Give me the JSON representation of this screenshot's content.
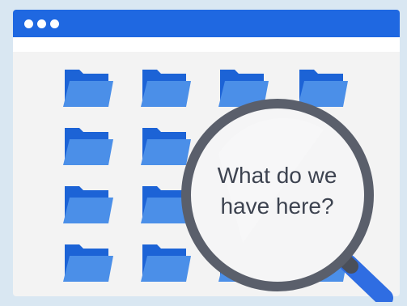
{
  "window": {
    "title_controls": [
      "dot",
      "dot",
      "dot"
    ],
    "colors": {
      "titlebar": "#1f68e1",
      "folder_front": "#4b8fe8",
      "folder_back": "#1c63d6",
      "lens_ring": "#5a5f6b",
      "handle": "#2f6de2"
    }
  },
  "magnifier": {
    "line1": "What do we",
    "line2": "have here?"
  },
  "folders": [
    {
      "name": "folder"
    },
    {
      "name": "folder"
    },
    {
      "name": "folder"
    },
    {
      "name": "folder"
    },
    {
      "name": "folder"
    },
    {
      "name": "folder"
    },
    {
      "name": "folder"
    },
    {
      "name": "folder"
    },
    {
      "name": "folder"
    },
    {
      "name": "folder"
    },
    {
      "name": "folder"
    },
    {
      "name": "folder"
    },
    {
      "name": "folder"
    },
    {
      "name": "folder"
    },
    {
      "name": "folder"
    },
    {
      "name": "folder"
    }
  ]
}
